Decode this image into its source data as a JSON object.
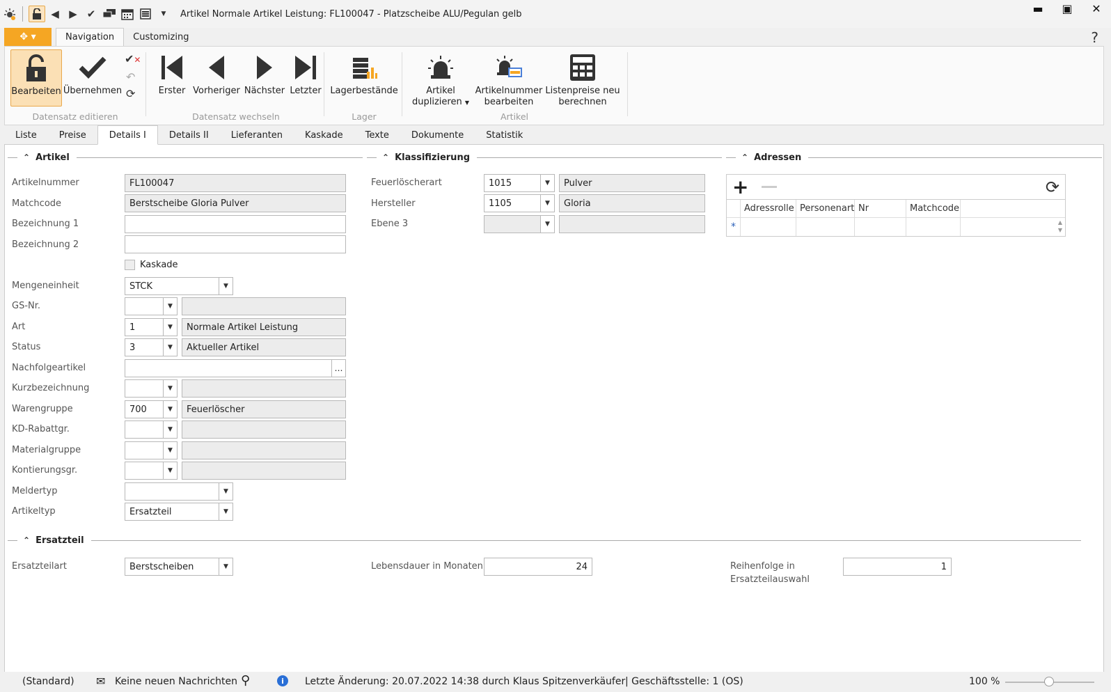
{
  "window": {
    "title": "Artikel Normale Artikel Leistung: FL100047 - Platzscheibe ALU/Pegulan gelb",
    "controls": [
      "minimize-icon",
      "maximize-icon",
      "close-icon"
    ]
  },
  "quick_access": [
    "sun-alarm-icon",
    "lock-icon",
    "back-icon",
    "forward-icon",
    "check-icon",
    "chat-icon",
    "calendar-icon",
    "list-icon",
    "dropdown-icon"
  ],
  "ribbon_tabs": [
    "Navigation",
    "Customizing"
  ],
  "help": "?",
  "ribbon": {
    "groups": [
      {
        "label": "Datensatz editieren",
        "buttons": [
          "Bearbeiten",
          "Übernehmen"
        ]
      },
      {
        "label": "Datensatz wechseln",
        "buttons": [
          "Erster",
          "Vorheriger",
          "Nächster",
          "Letzter"
        ]
      },
      {
        "label": "Lager",
        "buttons": [
          "Lagerbestände"
        ]
      },
      {
        "label": "Artikel",
        "buttons": [
          "Artikel duplizieren",
          "Artikelnummer bearbeiten",
          "Listenpreise neu berechnen"
        ]
      }
    ],
    "btn": {
      "bearbeiten": "Bearbeiten",
      "uebernehmen": "Übernehmen",
      "erster": "Erster",
      "vorheriger": "Vorheriger",
      "naechster": "Nächster",
      "letzter": "Letzter",
      "lager": "Lagerbestände",
      "dup1": "Artikel",
      "dup2": "duplizieren",
      "nr1": "Artikelnummer",
      "nr2": "bearbeiten",
      "lp1": "Listenpreise neu",
      "lp2": "berechnen"
    },
    "group_labels": {
      "edit": "Datensatz editieren",
      "nav": "Datensatz wechseln",
      "lager": "Lager",
      "artikel": "Artikel"
    }
  },
  "page_tabs": [
    "Liste",
    "Preise",
    "Details I",
    "Details II",
    "Lieferanten",
    "Kaskade",
    "Texte",
    "Dokumente",
    "Statistik"
  ],
  "active_tab": "Details I",
  "sections": {
    "artikel": "Artikel",
    "klassifizierung": "Klassifizierung",
    "adressen": "Adressen",
    "ersatzteil": "Ersatzteil"
  },
  "artikel": {
    "artikelnummer": {
      "label": "Artikelnummer",
      "value": "FL100047"
    },
    "matchcode": {
      "label": "Matchcode",
      "value": "Berstscheibe Gloria Pulver"
    },
    "bez1": {
      "label": "Bezeichnung 1",
      "value": ""
    },
    "bez2": {
      "label": "Bezeichnung 2",
      "value": ""
    },
    "kaskade": {
      "label": "Kaskade",
      "checked": false
    },
    "mengeneinheit": {
      "label": "Mengeneinheit",
      "value": "STCK"
    },
    "gsnr": {
      "label": "GS-Nr.",
      "code": "",
      "text": ""
    },
    "art": {
      "label": "Art",
      "code": "1",
      "text": "Normale Artikel Leistung"
    },
    "status": {
      "label": "Status",
      "code": "3",
      "text": "Aktueller Artikel"
    },
    "nachfolge": {
      "label": "Nachfolgeartikel",
      "value": ""
    },
    "kurzbez": {
      "label": "Kurzbezeichnung",
      "code": "",
      "text": ""
    },
    "warengruppe": {
      "label": "Warengruppe",
      "code": "700",
      "text": "Feuerlöscher"
    },
    "kdrabatt": {
      "label": "KD-Rabattgr.",
      "code": "",
      "text": ""
    },
    "materialgruppe": {
      "label": "Materialgruppe",
      "code": "",
      "text": ""
    },
    "kontierung": {
      "label": "Kontierungsgr.",
      "code": "",
      "text": ""
    },
    "meldertyp": {
      "label": "Meldertyp",
      "value": ""
    },
    "artikeltyp": {
      "label": "Artikeltyp",
      "value": "Ersatzteil"
    }
  },
  "klassifizierung": {
    "feuerloescherart": {
      "label": "Feuerlöscherart",
      "code": "1015",
      "text": "Pulver"
    },
    "hersteller": {
      "label": "Hersteller",
      "code": "1105",
      "text": "Gloria"
    },
    "ebene3": {
      "label": "Ebene 3",
      "code": "",
      "text": ""
    }
  },
  "adressen": {
    "columns": [
      "Adressrolle",
      "Personenart",
      "Nr",
      "Matchcode"
    ],
    "new_row_marker": "*"
  },
  "ersatzteil": {
    "ersatzteilart": {
      "label": "Ersatzteilart",
      "value": "Berstscheiben"
    },
    "lebensdauer": {
      "label": "Lebensdauer in Monaten",
      "value": "24"
    },
    "reihenfolge": {
      "label1": "Reihenfolge in",
      "label2": "Ersatzteilauswahl",
      "value": "1"
    }
  },
  "statusbar": {
    "layout": "(Standard)",
    "messages": "Keine neuen Nachrichten",
    "last_change": "Letzte Änderung: 20.07.2022 14:38 durch Klaus Spitzenverkäufer",
    "branch": "| Geschäftsstelle:  1 (OS)",
    "zoom": "100 %",
    "zoom_value": 100
  },
  "colors": {
    "accent_orange": "#f5a623",
    "selected_button": "#fbe0b5"
  }
}
